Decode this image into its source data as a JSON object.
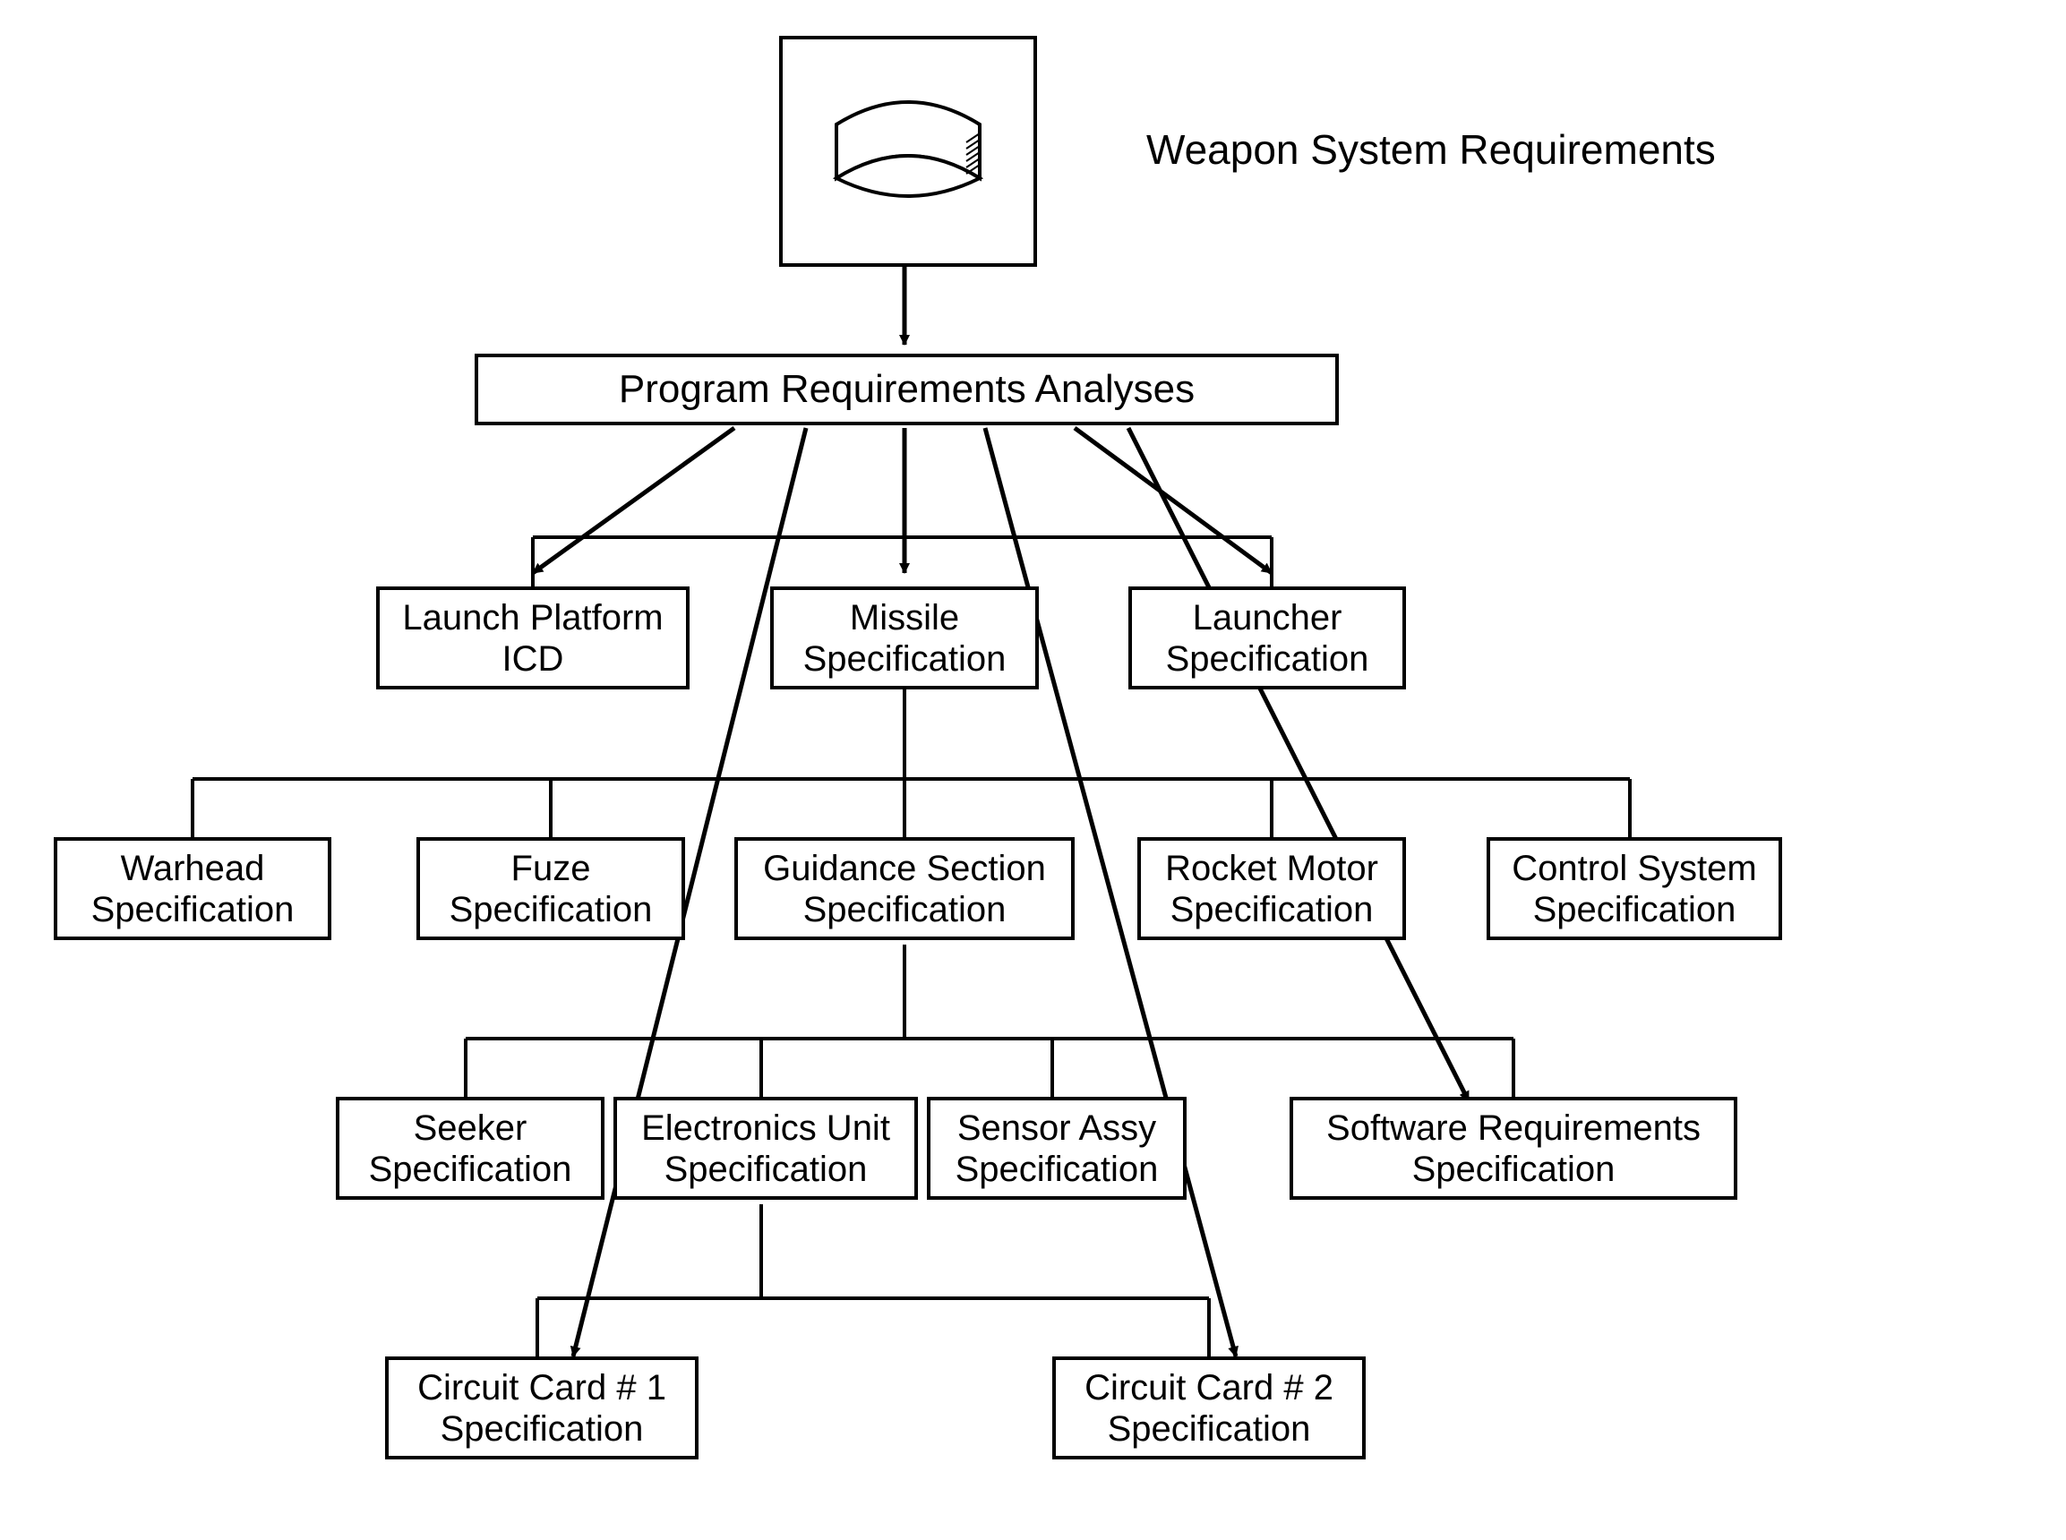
{
  "diagram": {
    "title": "Weapon System Requirements",
    "root_box": "Program Requirements Analyses",
    "level1": {
      "launch_platform": "Launch Platform\nICD",
      "missile": "Missile\nSpecification",
      "launcher": "Launcher\nSpecification"
    },
    "level2": {
      "warhead": "Warhead\nSpecification",
      "fuze": "Fuze\nSpecification",
      "guidance": "Guidance Section\nSpecification",
      "rocket_motor": "Rocket Motor\nSpecification",
      "control_system": "Control System\nSpecification"
    },
    "level3": {
      "seeker": "Seeker\nSpecification",
      "electronics": "Electronics Unit\nSpecification",
      "sensor": "Sensor Assy\nSpecification",
      "software": "Software Requirements\nSpecification"
    },
    "level4": {
      "cc1": "Circuit Card # 1\nSpecification",
      "cc2": "Circuit Card # 2\nSpecification"
    }
  }
}
